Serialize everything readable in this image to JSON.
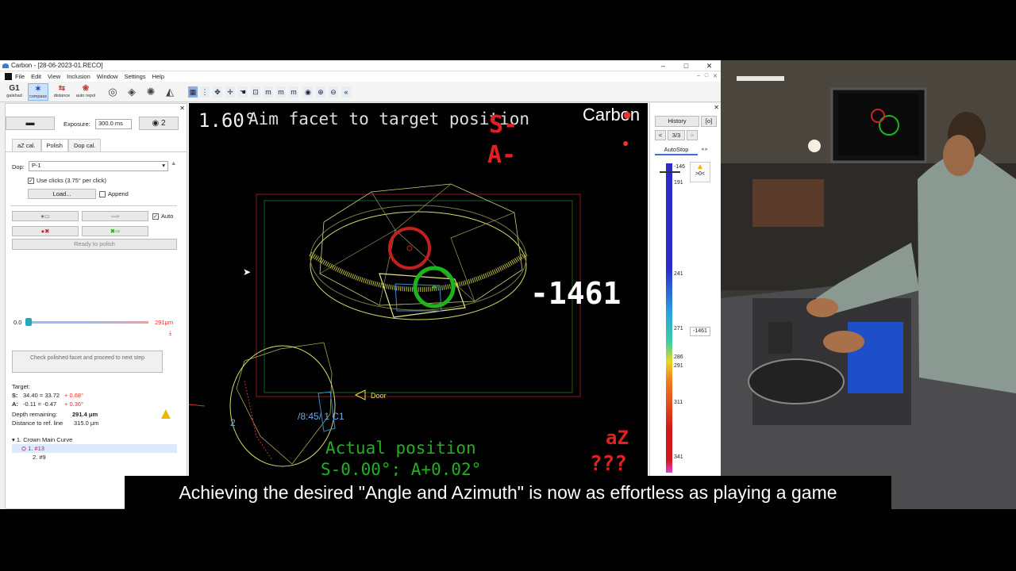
{
  "window": {
    "title": "Carbon - [28-06-2023-01.RECO]",
    "controls": [
      "–",
      "□",
      "✕"
    ],
    "mdi_controls": [
      "–",
      "□",
      "✕"
    ]
  },
  "menu": [
    "File",
    "Edit",
    "View",
    "Inclusion",
    "Window",
    "Settings",
    "Help"
  ],
  "toolbar": {
    "tools": [
      {
        "icon": "G1",
        "label": "galahad"
      },
      {
        "icon": "✶",
        "label": "compass"
      },
      {
        "icon": "⇆",
        "label": "distance"
      },
      {
        "icon": "❀",
        "label": "auto repol"
      }
    ]
  },
  "left_panel": {
    "exposure_label": "Exposure:",
    "exposure_value": "300.0 ms",
    "camera_count": "2",
    "tabs": [
      "aZ cal.",
      "Polish",
      "Dop cal."
    ],
    "active_tab": "Polish",
    "dop_label": "Dop:",
    "dop_value": "P-1",
    "use_clicks": "Use clicks (3.75° per click)",
    "load_button": "Load...",
    "append_label": "Append",
    "auto_label": "Auto",
    "ready_button": "Ready to polish",
    "slider_min": "0.0",
    "slider_max": "291μm",
    "check_button": "Check polished facet and proceed to next step",
    "target_label": "Target:",
    "target_s_label": "S:",
    "target_s": "34.40 = 33.72",
    "target_s_delta": "+ 0.68°",
    "target_a_label": "A:",
    "target_a": "-0.11 = -0.47",
    "target_a_delta": "+ 0.36°",
    "depth_label": "Depth remaining:",
    "depth_value": "291.4 μm",
    "distance_label": "Distance to ref. line",
    "distance_value": "315.0 μm",
    "tree": {
      "root": "1. Crown Main Curve",
      "items": [
        "1. #13",
        "2. #9"
      ]
    }
  },
  "canvas": {
    "angle": "1.60°",
    "instruction": "Aim facet to target position",
    "logo": "Carbon",
    "s_indicator": "S-",
    "a_indicator": "A-",
    "big_value": "-1461",
    "door_label": "Door",
    "facet_label": "/8:45/  1 C1",
    "facet_number": "2",
    "actual_label": "Actual position",
    "actual_values": "S-0.00°; A+0.02°",
    "az_label": "aZ",
    "az_value": "???"
  },
  "right_panel": {
    "history_button": "History",
    "bracket_button": "[o]",
    "nav_prev": "<",
    "page": "3/3",
    "nav_next": ">",
    "autostop": "AutoStop",
    "top_value": "-146",
    "warn_label": ">0<",
    "scale": [
      "191",
      "241",
      "271",
      "286",
      "291",
      "311",
      "341"
    ],
    "current": "-1461"
  },
  "taskbar": {
    "icons": [
      "⊞",
      "▭",
      "▦",
      "⚙",
      "▬"
    ]
  },
  "subtitle": "Achieving the desired \"Angle and Azimuth\" is now as effortless as playing a game"
}
